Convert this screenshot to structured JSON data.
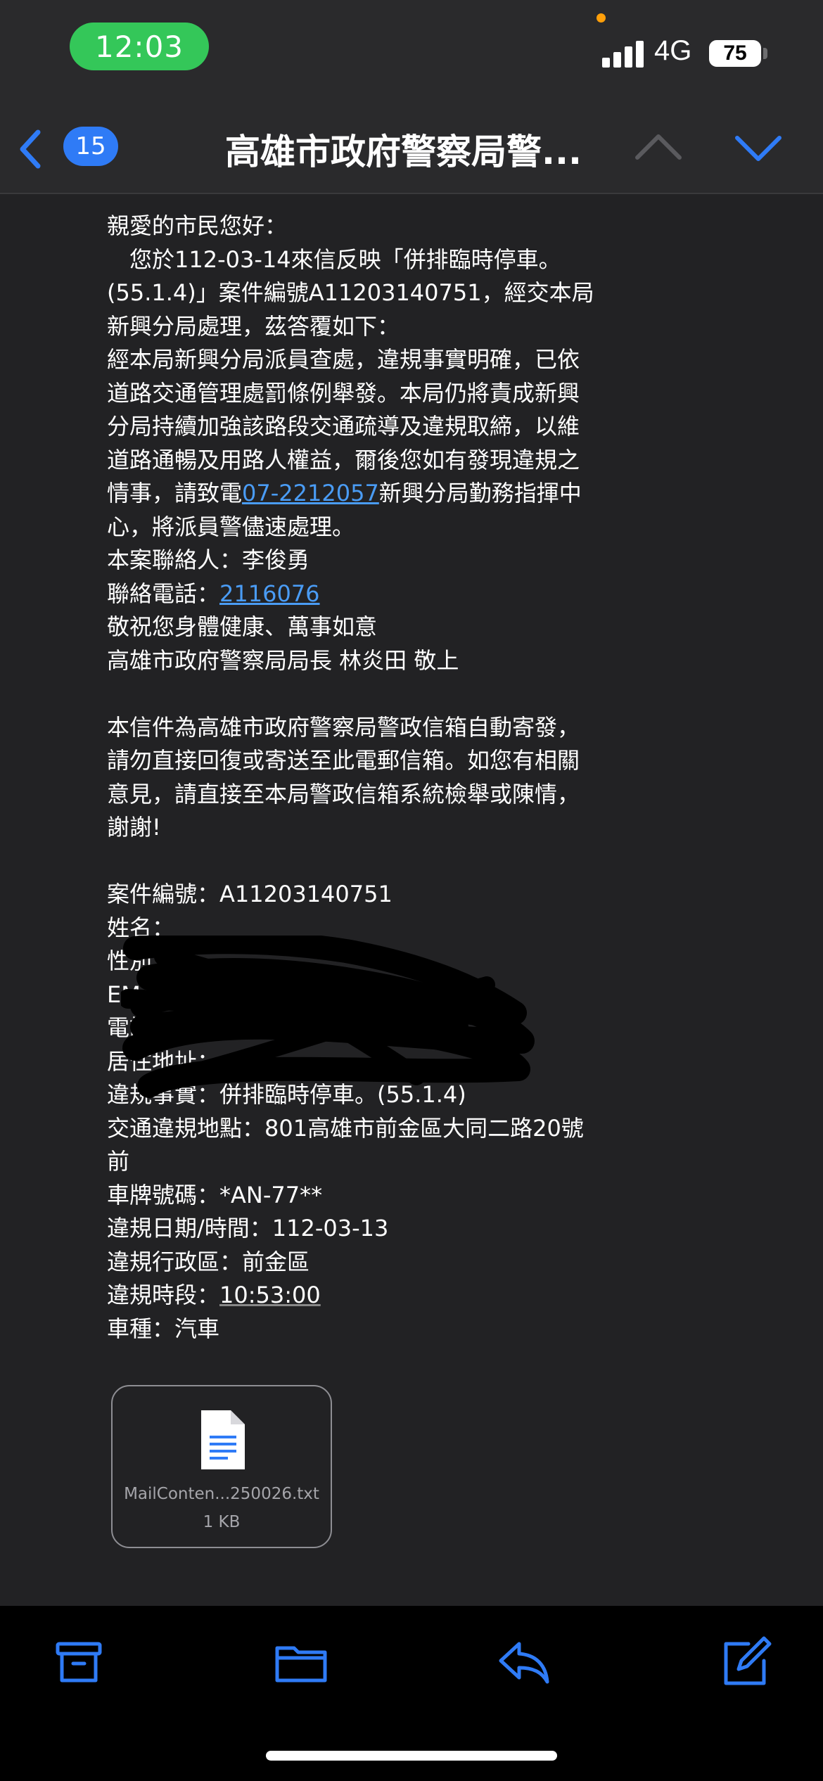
{
  "status_bar": {
    "time": "12:03",
    "network": "4G",
    "battery": "75"
  },
  "nav": {
    "message_count": "15",
    "title": "高雄市政府警察局警..."
  },
  "message": {
    "greeting": "親愛的市民您好：",
    "paragraph_1": "您於112-03-14來信反映「併排臨時停車。(55.1.4)」案件編號A11203140751，經交本局新興分局處理，茲答覆如下：",
    "paragraph_2_before_link": "經本局新興分局派員查處，違規事實明確，已依道路交通管理處罰條例舉發。本局仍將責成新興分局持續加強該路段交通疏導及違規取締，以維道路通暢及用路人權益，爾後您如有發現違規之情事，請致電",
    "phone_link": "07-2212057",
    "paragraph_2_after_link": "新興分局勤務指揮中心，將派員警儘速處理。",
    "contact_person": "本案聯絡人：李俊勇",
    "contact_phone_label": "聯絡電話：",
    "contact_phone": "2116076",
    "closing": "敬祝您身體健康、萬事如意",
    "signature": "高雄市政府警察局局長 林炎田 敬上",
    "auto_notice": "本信件為高雄市政府警察局警政信箱自動寄發，請勿直接回復或寄送至此電郵信箱。如您有相關意見，請直接至本局警政信箱系統檢舉或陳情，謝謝!",
    "details": {
      "case_number": "案件編號：A11203140751",
      "name_label": "姓名：",
      "gender_label": "性別：",
      "email_label": "EMail：",
      "phone_label": "電話：",
      "address_label": "居住地址：",
      "violation_fact": "違規事實：併排臨時停車。(55.1.4)",
      "location": "交通違規地點：801高雄市前金區大同二路20號前",
      "plate": "車牌號碼：*AN-77**",
      "date": "違規日期/時間：112-03-13",
      "district": "違規行政區：前金區",
      "time_label": "違規時段：",
      "time_value": "10:53:00",
      "vehicle_type": "車種：汽車"
    }
  },
  "attachment": {
    "filename": "MailConten...250026.txt",
    "size": "1 KB",
    "icon": "document-icon"
  },
  "toolbar": {
    "icons": [
      "archive-icon",
      "folder-icon",
      "reply-icon",
      "compose-icon"
    ]
  },
  "colors": {
    "accent": "#2f7bf6",
    "status_pill": "#34c759",
    "link": "#4a9cf5"
  }
}
